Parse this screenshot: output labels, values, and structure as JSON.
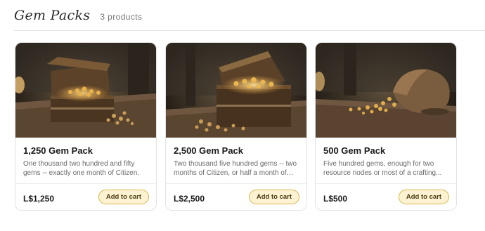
{
  "header": {
    "title": "Gem Packs",
    "count": "3 products"
  },
  "products": [
    {
      "name": "1,250 Gem Pack",
      "description": "One thousand two hundred and fifty gems -- exactly one month of Citizen.",
      "price": "L$1,250",
      "button_label": "Add to cart",
      "image_subject": "open treasure chest with gems"
    },
    {
      "name": "2,500 Gem Pack",
      "description": "Two thousand five hundred gems -- two months of Citizen, or half a month of Wor...",
      "price": "L$2,500",
      "button_label": "Add to cart",
      "image_subject": "large open treasure chest with gems"
    },
    {
      "name": "500 Gem Pack",
      "description": "Five hundred gems, enough for two resource nodes or most of a crafting...",
      "price": "L$500",
      "button_label": "Add to cart",
      "image_subject": "sack of gems spilling on table"
    }
  ],
  "colors": {
    "accent_button_bg": "#fdf3d2",
    "accent_button_border": "#d9b44a"
  }
}
